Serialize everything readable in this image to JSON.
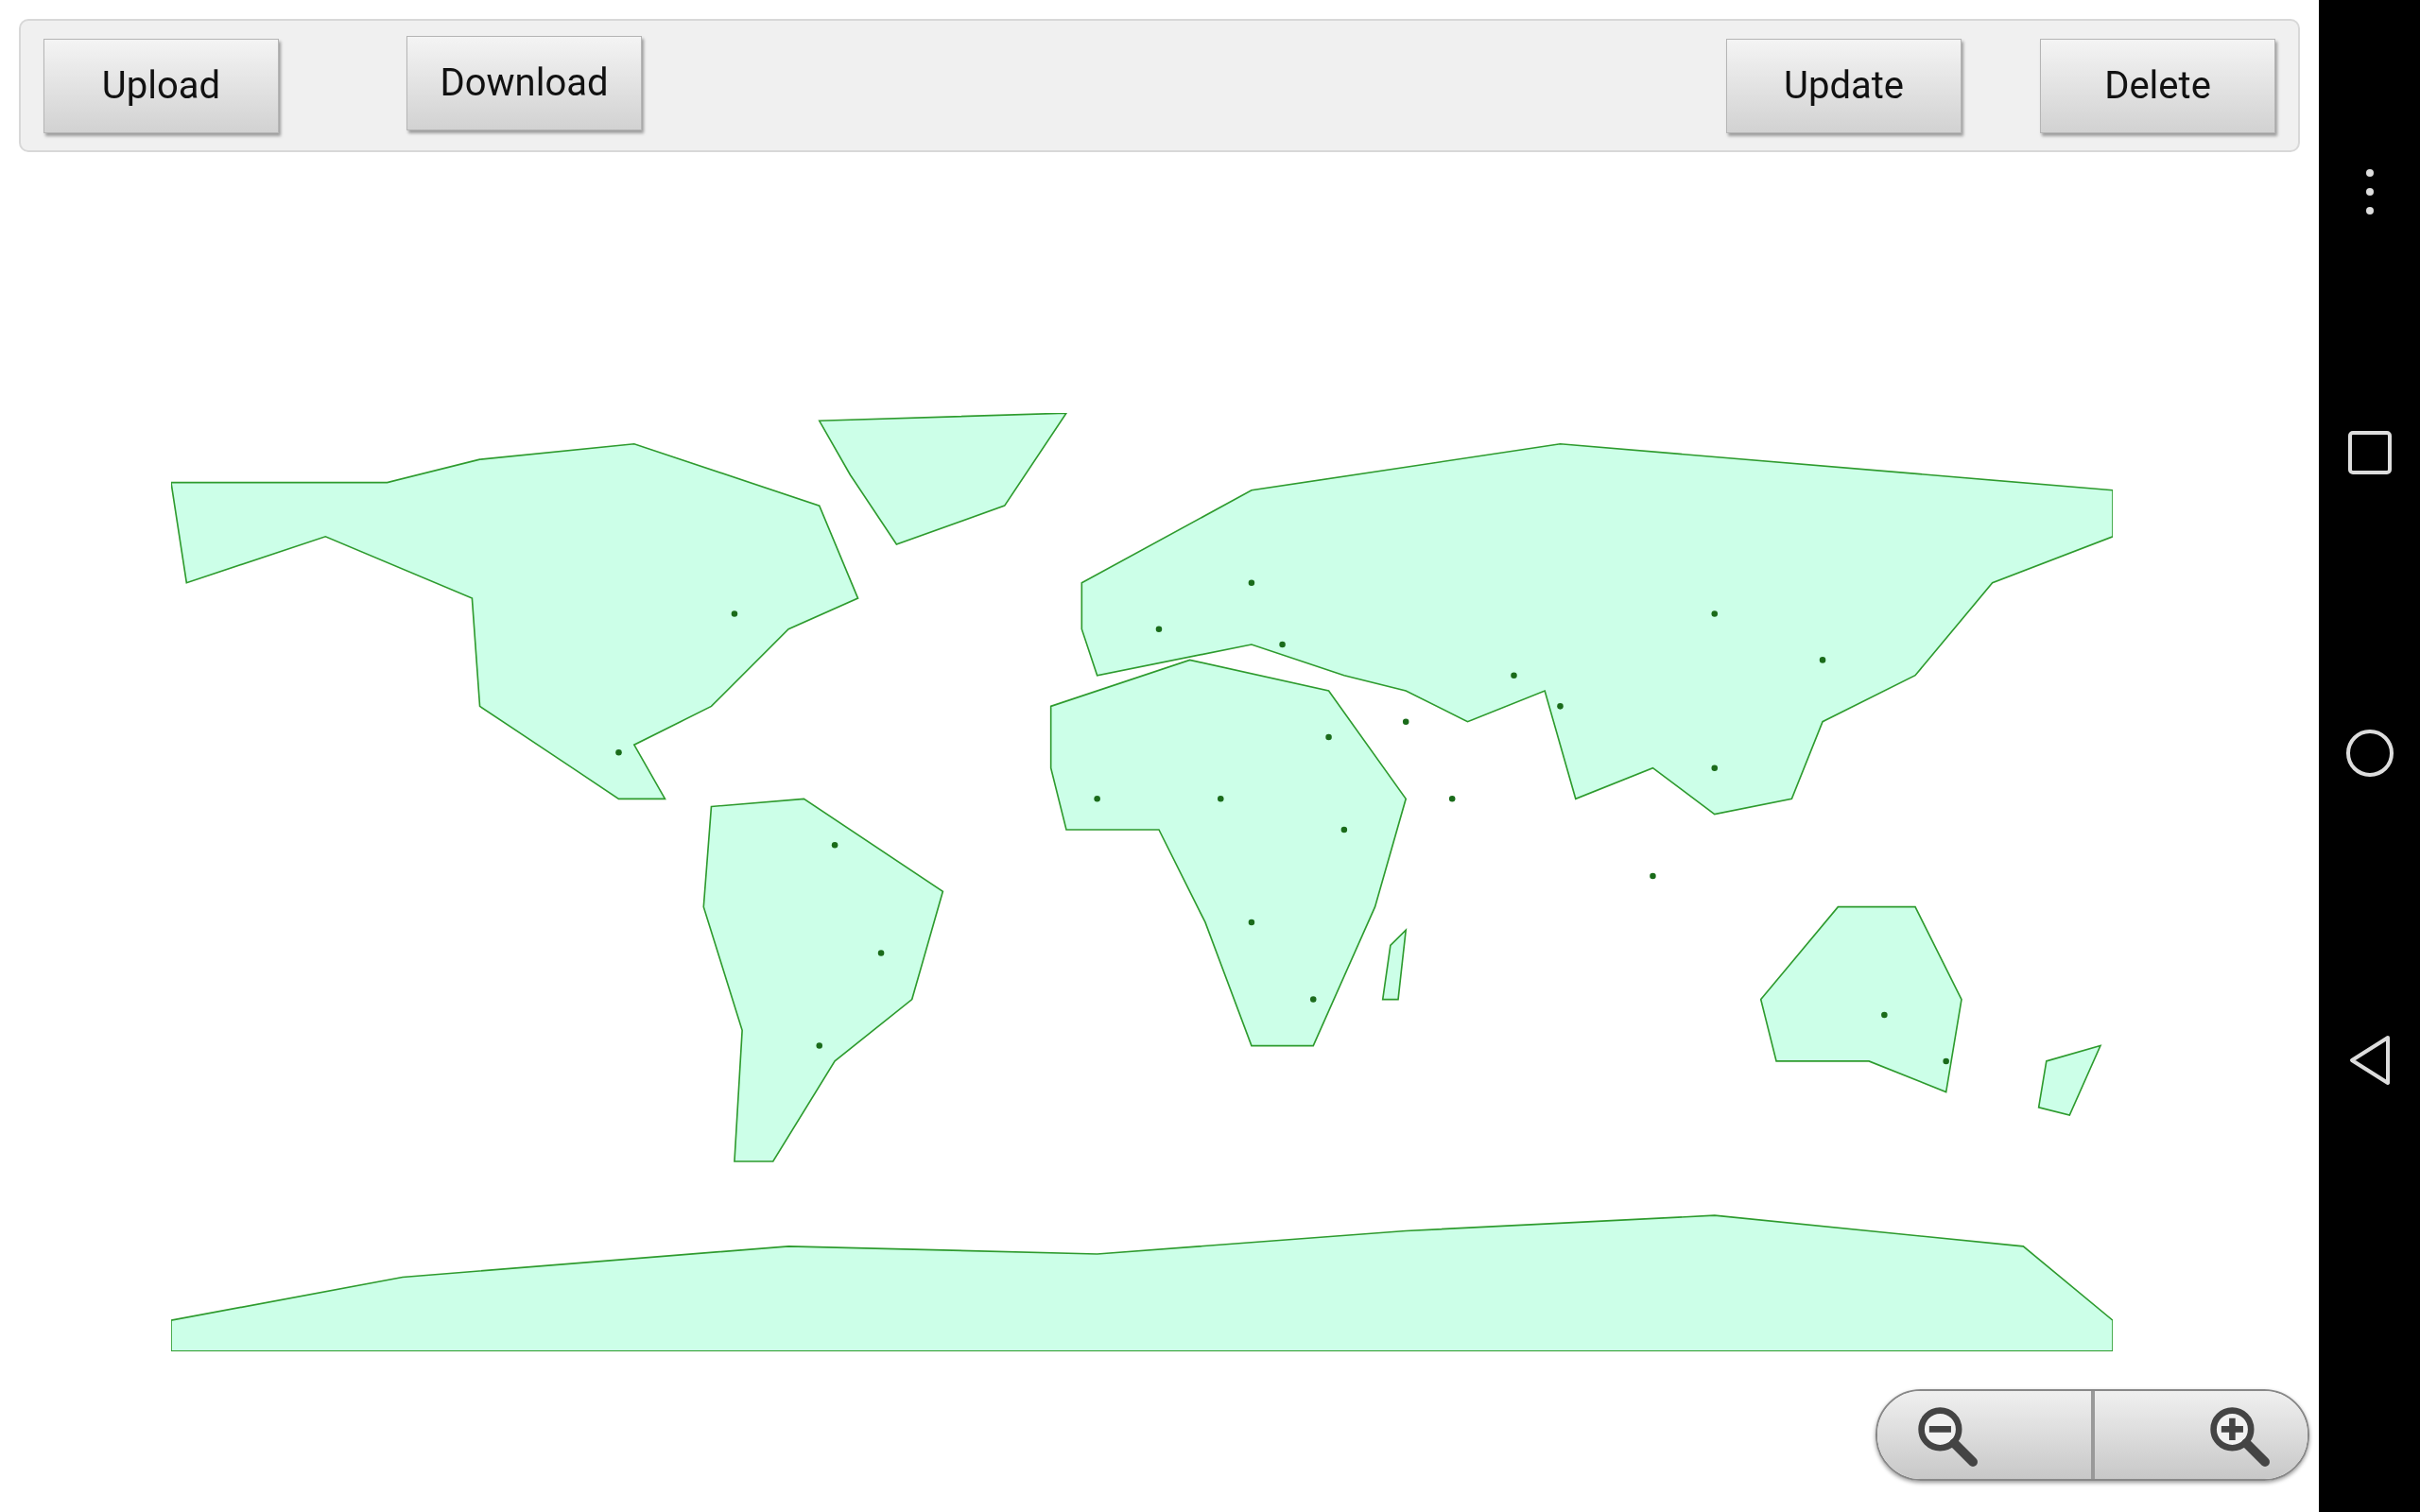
{
  "toolbar": {
    "buttons": [
      {
        "label": "Upload",
        "kind": "left"
      },
      {
        "label": "Download",
        "kind": "left"
      },
      {
        "label": "Update",
        "kind": "right"
      },
      {
        "label": "Delete",
        "kind": "right"
      }
    ]
  }
}
